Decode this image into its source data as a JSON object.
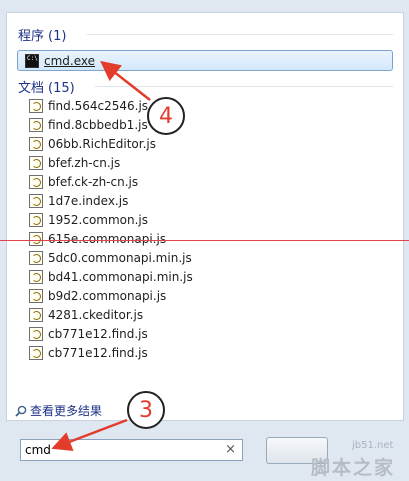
{
  "programs": {
    "header": "程序",
    "count": "(1)",
    "items": [
      {
        "label": "cmd.exe",
        "icon": "cmd-icon",
        "selected": true
      }
    ]
  },
  "documents": {
    "header": "文档",
    "count": "(15)",
    "items": [
      {
        "label": "find.564c2546.js"
      },
      {
        "label": "find.8cbbedb1.js"
      },
      {
        "label": "06bb.RichEditor.js"
      },
      {
        "label": "bfef.zh-cn.js"
      },
      {
        "label": "bfef.ck-zh-cn.js"
      },
      {
        "label": "1d7e.index.js"
      },
      {
        "label": "1952.common.js"
      },
      {
        "label": "615e.commonapi.js"
      },
      {
        "label": "5dc0.commonapi.min.js"
      },
      {
        "label": "bd41.commonapi.min.js"
      },
      {
        "label": "b9d2.commonapi.js"
      },
      {
        "label": "4281.ckeditor.js"
      },
      {
        "label": "cb771e12.find.js"
      },
      {
        "label": "cb771e12.find.js"
      }
    ]
  },
  "see_more": "查看更多结果",
  "search": {
    "value": "cmd",
    "clear": "×"
  },
  "annotations": {
    "step3": "3",
    "step4": "4"
  },
  "watermark": {
    "site": "jb51.net",
    "brand": "脚本之家"
  },
  "colors": {
    "arrow": "#e23c2c",
    "header": "#1e3287",
    "selection": "#d3e8fb"
  }
}
